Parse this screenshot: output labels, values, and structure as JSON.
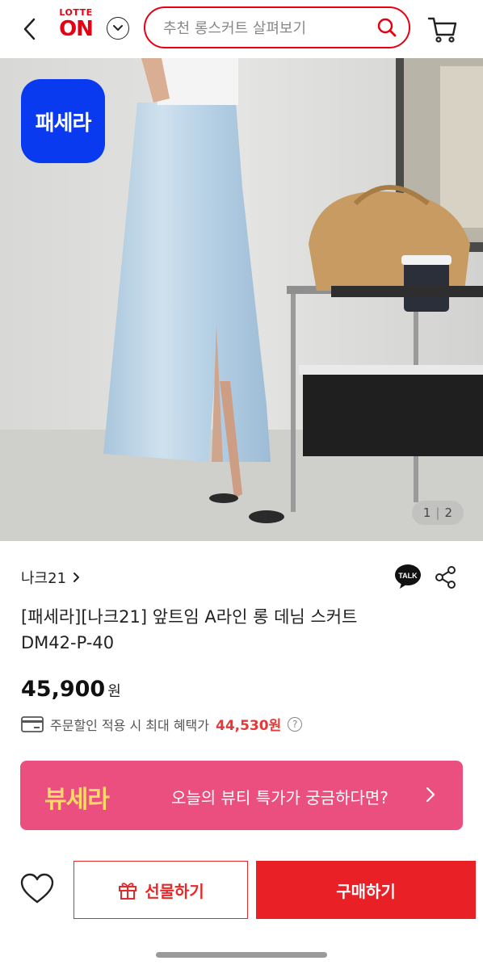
{
  "header": {
    "logo_top": "LOTTE",
    "logo_main": "ON",
    "search_placeholder": "추천 롱스커트 살펴보기",
    "brand_color": "#e60012"
  },
  "hero": {
    "badge_text": "패세라",
    "badge_color": "#0a3af0",
    "pager_current": "1",
    "pager_sep": "|",
    "pager_total": "2"
  },
  "product": {
    "brand": "나크21",
    "title_line1": "[패세라][나크21] 앞트임 A라인 롱 데님 스커트",
    "title_line2": "DM42-P-40",
    "price": "45,900",
    "price_unit": "원",
    "benefit_text": "주문할인 적용 시 최대 혜택가",
    "benefit_price": "44,530원",
    "talk_label": "TALK"
  },
  "banner": {
    "logo_text": "뷰세라",
    "message": "오늘의 뷰티 특가가 궁금하다면?",
    "bg_color": "#ea4f80"
  },
  "actions": {
    "gift_label": "선물하기",
    "buy_label": "구매하기",
    "accent_color": "#ea2027"
  }
}
